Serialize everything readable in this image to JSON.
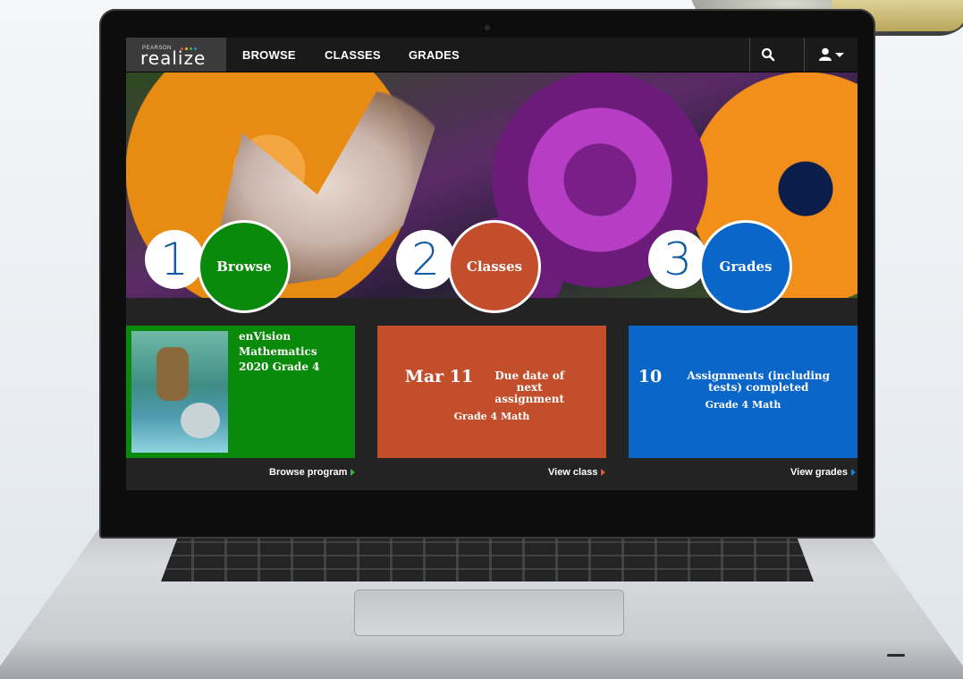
{
  "nav": {
    "logo_brand": "PEARSON",
    "logo_product": "realize",
    "links": [
      "BROWSE",
      "CLASSES",
      "GRADES"
    ],
    "search_icon": "search-icon",
    "user_icon": "user-menu-icon"
  },
  "hero": {
    "steps": [
      {
        "number": "1",
        "label": "Browse",
        "color": "#0a8a0a"
      },
      {
        "number": "2",
        "label": "Classes",
        "color": "#c24e2c"
      },
      {
        "number": "3",
        "label": "Grades",
        "color": "#0b66c9"
      }
    ]
  },
  "cards": {
    "browse": {
      "title": "enVision Mathematics 2020 Grade 4",
      "link": "Browse program",
      "color": "#0a8a0a"
    },
    "classes": {
      "big": "Mar 11",
      "desc": "Due date of next assignment",
      "sub": "Grade 4 Math",
      "link": "View class",
      "color": "#c24e2c"
    },
    "grades": {
      "big": "10",
      "desc": "Assignments (including tests) completed",
      "sub": "Grade 4 Math",
      "link": "View grades",
      "color": "#0b66c9"
    }
  },
  "colors": {
    "link_arrow_green": "#3fb23f",
    "link_arrow_orange": "#e35a36",
    "link_arrow_blue": "#1e79e0"
  }
}
